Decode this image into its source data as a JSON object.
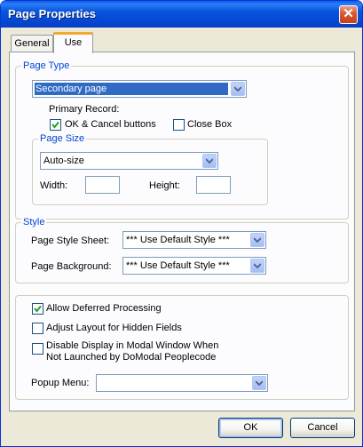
{
  "window": {
    "title": "Page Properties",
    "close_glyph": "✕"
  },
  "tabs": [
    {
      "label": "General",
      "active": false
    },
    {
      "label": "Use",
      "active": true
    }
  ],
  "page_type": {
    "legend": "Page Type",
    "selected": "Secondary page",
    "primary_record_label": "Primary Record:",
    "ok_cancel": {
      "label": "OK & Cancel buttons",
      "checked": true
    },
    "close_box": {
      "label": "Close Box",
      "checked": false
    },
    "page_size": {
      "legend": "Page Size",
      "selected": "Auto-size",
      "width_label": "Width:",
      "width_value": "",
      "height_label": "Height:",
      "height_value": ""
    }
  },
  "style": {
    "legend": "Style",
    "sheet_label": "Page Style Sheet:",
    "sheet_value": "*** Use Default Style ***",
    "background_label": "Page Background:",
    "background_value": "*** Use Default Style ***"
  },
  "options": {
    "allow_deferred": {
      "label": "Allow Deferred Processing",
      "checked": true
    },
    "adjust_layout": {
      "label": "Adjust Layout for Hidden Fields",
      "checked": false
    },
    "disable_modal": {
      "label_line1": "Disable Display in Modal Window When",
      "label_line2": "Not Launched by DoModal Peoplecode",
      "checked": false
    },
    "popup_label": "Popup Menu:",
    "popup_value": ""
  },
  "buttons": {
    "ok": "OK",
    "cancel": "Cancel"
  },
  "colors": {
    "accent": "#0046d5",
    "titlebar": "#0855dd",
    "selection": "#316ac5"
  }
}
